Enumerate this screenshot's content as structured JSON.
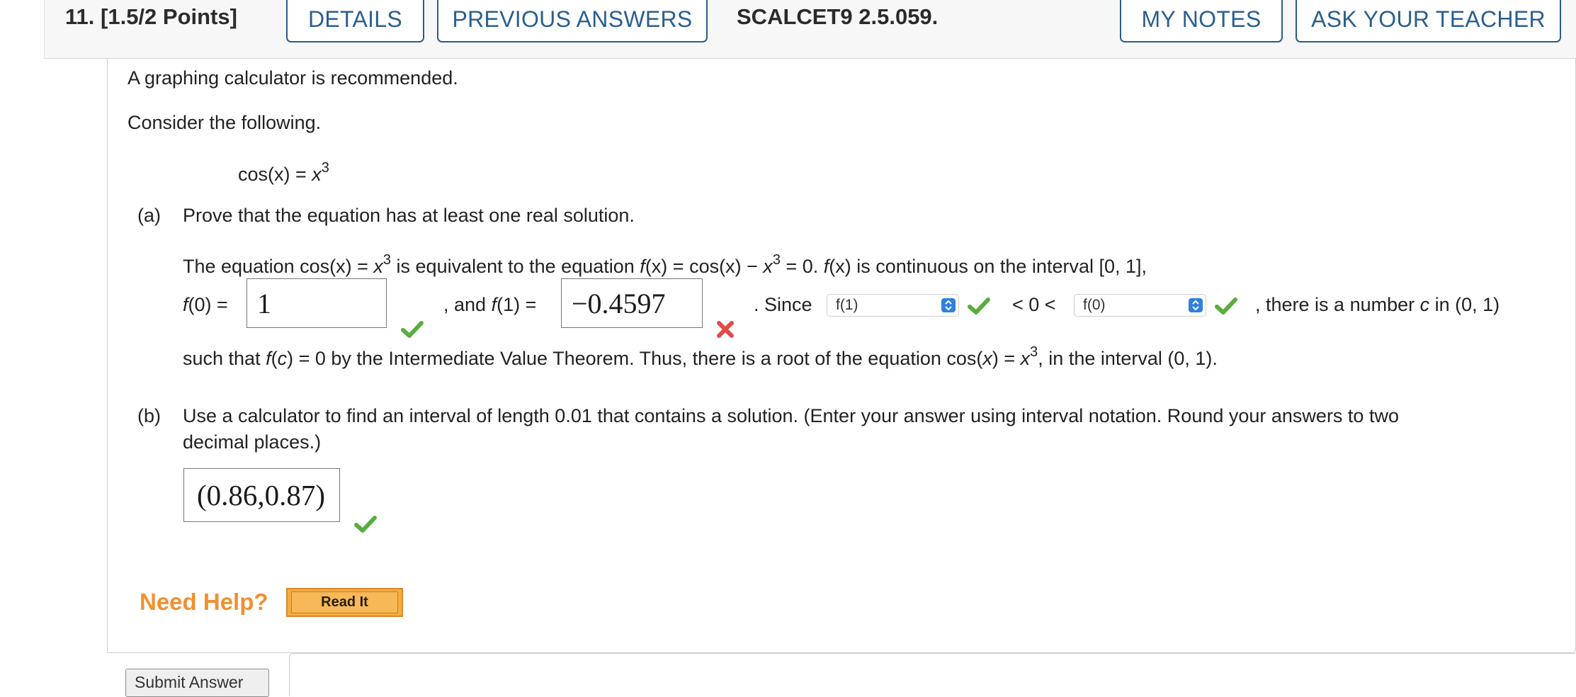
{
  "header": {
    "question_number": "11.",
    "points": "[1.5/2 Points]",
    "details_label": "DETAILS",
    "previous_answers_label": "PREVIOUS ANSWERS",
    "source_code": "SCALCET9 2.5.059.",
    "my_notes_label": "MY NOTES",
    "ask_teacher_label": "ASK YOUR TEACHER"
  },
  "intro": {
    "calculator_note": "A graphing calculator is recommended.",
    "consider": "Consider the following.",
    "equation_lhs": "cos(x) = ",
    "equation_var": "x",
    "equation_exp": "3"
  },
  "part_a": {
    "label": "(a)",
    "prompt": "Prove that the equation has at least one real solution.",
    "line1_a": "The equation cos(x) = ",
    "line1_b": " is equivalent to the equation ",
    "line1_c": "(x) = cos(x) − ",
    "line1_d": " = 0. ",
    "line1_e": "(x) is continuous on the interval [0, 1],",
    "f0_label_rest": "(0) = ",
    "f0_value": "1",
    "and_f1_text": ", and ",
    "f1_label_rest": "(1) = ",
    "f1_value": "−0.4597",
    "since_text": ". Since",
    "select1_value": "f(1)",
    "lt0lt_text": "< 0 <",
    "select2_value": "f(0)",
    "there_is_text": ", there is a number ",
    "c_var": "c",
    "in_interval_text": " in (0, 1)",
    "line3_a": "such that ",
    "line3_b": "(",
    "line3_c": ") = 0 by the Intermediate Value Theorem. Thus, there is a root of the equation cos(",
    "line3_d": ") = ",
    "line3_e": ", in the interval (0, 1)."
  },
  "part_b": {
    "label": "(b)",
    "prompt_line1": "Use a calculator to find an interval of length 0.01 that contains a solution. (Enter your answer using interval notation. Round your answers to two",
    "prompt_line2": "decimal places.)",
    "answer_value": "(0.86,0.87)"
  },
  "help": {
    "need_help_label": "Need Help?",
    "read_it_label": "Read It"
  },
  "submit_label": "Submit Answer",
  "colors": {
    "accent_blue": "#2a5f90",
    "check_green": "#5aad3f",
    "cross_red": "#e04b4b",
    "help_orange": "#f2902f"
  }
}
